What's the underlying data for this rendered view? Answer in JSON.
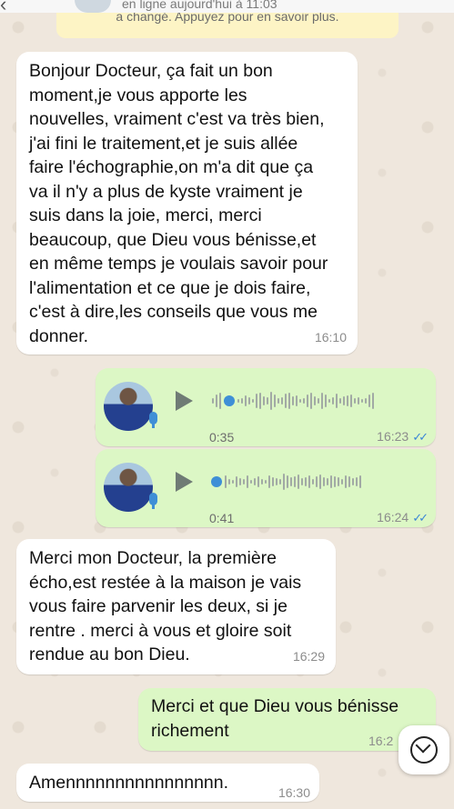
{
  "header": {
    "status": "en ligne aujourd'hui à 11:03"
  },
  "notice": {
    "text": "a changé. Appuyez pour en savoir plus."
  },
  "messages": [
    {
      "direction": "in",
      "text": "Bonjour Docteur, ça fait un bon\nmoment,je vous apporte les\nnouvelles, vraiment c'est va très bien,\nj'ai fini le traitement,et je suis allée\nfaire l'échographie,on m'a dit que ça\nva il n'y a plus de kyste vraiment je\nsuis dans la joie, merci, merci\nbeaucoup, que Dieu vous bénisse,et\nen même temps je voulais savoir pour\nl'alimentation et ce que je dois faire,\nc'est à dire,les conseils que vous me\ndonner.",
      "time": "16:10"
    },
    {
      "direction": "out",
      "type": "voice",
      "duration": "0:35",
      "time": "16:23",
      "ticks": "✓✓",
      "progress": 0.05
    },
    {
      "direction": "out",
      "type": "voice",
      "duration": "0:41",
      "time": "16:24",
      "ticks": "✓✓",
      "progress": 0.0
    },
    {
      "direction": "in",
      "text": "Merci mon Docteur, la première\nécho,est restée à la maison je vais\nvous faire parvenir les deux, si je\nrentre . merci à vous et gloire soit\nrendue au bon Dieu.",
      "time": "16:29"
    },
    {
      "direction": "out",
      "text": "Merci et que Dieu vous bénisse\nrichement",
      "time": "16:2"
    },
    {
      "direction": "in",
      "text": "Amennnnnnnnnnnnnnnn.",
      "time": "16:30"
    }
  ],
  "icons": {
    "back": "chevron-left-icon",
    "play": "play-icon",
    "mic": "microphone-icon",
    "scroll": "scroll-down-icon"
  },
  "colors": {
    "incoming_bubble": "#ffffff",
    "outgoing_bubble": "#dcf7c5",
    "read_ticks": "#3b86d6",
    "notice_bg": "#fdf4c5"
  }
}
